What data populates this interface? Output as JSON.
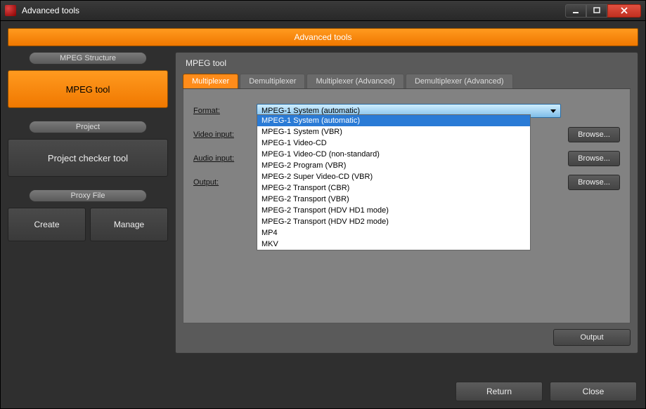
{
  "window": {
    "title": "Advanced tools"
  },
  "header": {
    "title": "Advanced tools"
  },
  "sidebar": {
    "sections": [
      {
        "header": "MPEG Structure",
        "buttons": [
          {
            "label": "MPEG tool",
            "active": true
          }
        ]
      },
      {
        "header": "Project",
        "buttons": [
          {
            "label": "Project checker tool"
          }
        ]
      },
      {
        "header": "Proxy File",
        "buttons": [
          {
            "label": "Create"
          },
          {
            "label": "Manage"
          }
        ]
      }
    ]
  },
  "panel": {
    "title": "MPEG tool",
    "tabs": [
      {
        "label": "Multiplexer",
        "active": true
      },
      {
        "label": "Demultiplexer"
      },
      {
        "label": "Multiplexer (Advanced)"
      },
      {
        "label": "Demultiplexer (Advanced)"
      }
    ],
    "form": {
      "format_label": "Format:",
      "video_label": "Video input:",
      "audio_label": "Audio input:",
      "output_label": "Output:",
      "browse_label": "Browse...",
      "format_selected": "MPEG-1 System (automatic)",
      "format_options": [
        "MPEG-1 System (automatic)",
        "MPEG-1 System (VBR)",
        "MPEG-1 Video-CD",
        "MPEG-1 Video-CD (non-standard)",
        "MPEG-2 Program (VBR)",
        "MPEG-2 Super Video-CD (VBR)",
        "MPEG-2 Transport (CBR)",
        "MPEG-2 Transport (VBR)",
        "MPEG-2 Transport (HDV HD1 mode)",
        "MPEG-2 Transport (HDV HD2 mode)",
        "MP4",
        "MKV"
      ]
    },
    "output_button": "Output"
  },
  "footer": {
    "return_label": "Return",
    "close_label": "Close"
  }
}
